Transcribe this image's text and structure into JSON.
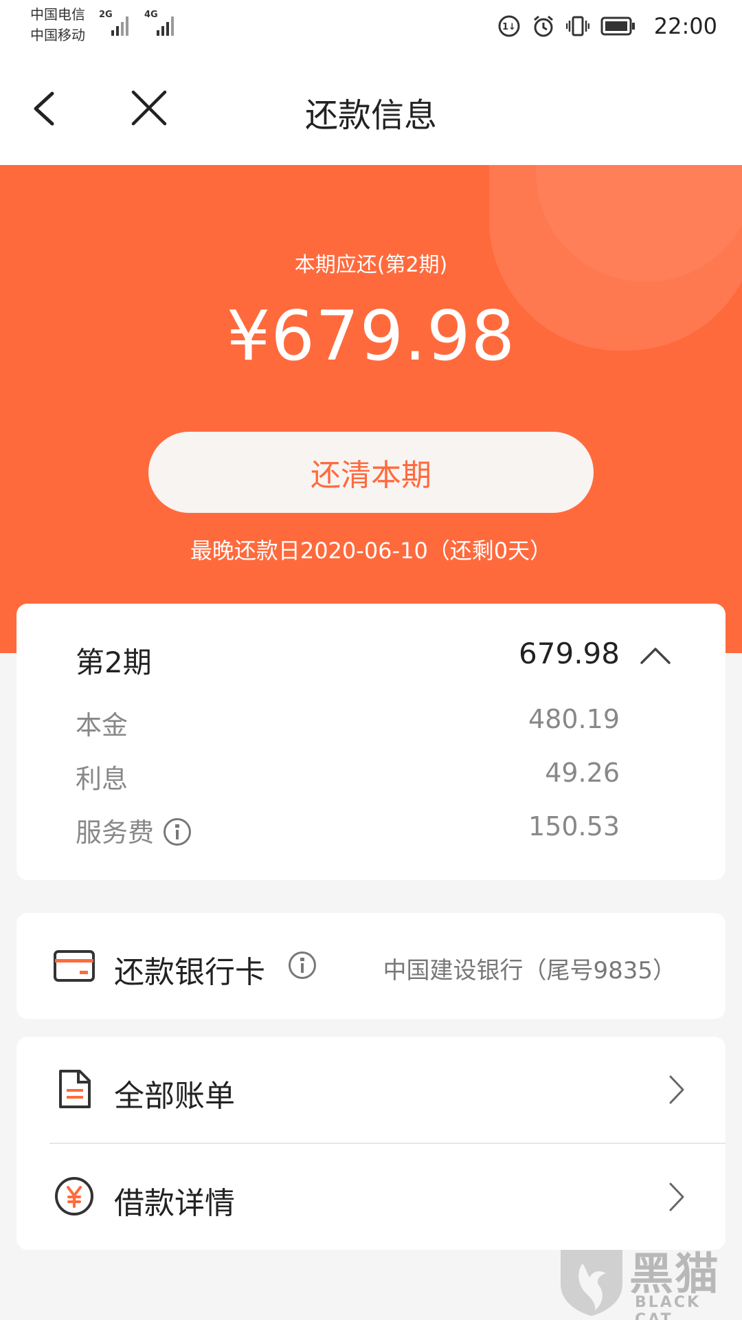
{
  "status_bar": {
    "carrier_1": "中国电信",
    "carrier_2": "中国移动",
    "signal_1_tag": "2G",
    "signal_2_tag": "4G",
    "time": "22:00",
    "icons": [
      "data-saver-icon",
      "alarm-icon",
      "vibrate-icon",
      "battery-icon"
    ]
  },
  "nav": {
    "title": "还款信息",
    "back_icon": "chevron-left-icon",
    "close_icon": "close-icon"
  },
  "hero": {
    "period_label": "本期应还(第2期)",
    "amount": "¥679.98",
    "pay_button": "还清本期",
    "due_date": "最晚还款日2020-06-10（还剩0天）",
    "background_color": "#ff6a3d"
  },
  "breakdown": {
    "period": "第2期",
    "total": "679.98",
    "toggle_icon": "chevron-up-icon",
    "rows": [
      {
        "label": "本金",
        "value": "480.19"
      },
      {
        "label": "利息",
        "value": "49.26"
      },
      {
        "label": "服务费",
        "value": "150.53",
        "has_info": true
      }
    ]
  },
  "bank_card": {
    "icon": "card-icon",
    "label": "还款银行卡",
    "value": "中国建设银行（尾号9835）"
  },
  "links": [
    {
      "icon": "document-icon",
      "label": "全部账单"
    },
    {
      "icon": "yuan-circle-icon",
      "label": "借款详情"
    }
  ],
  "watermark": {
    "text": "黑猫",
    "sub": "BLACK CAT"
  },
  "colors": {
    "accent": "#ff6a3d",
    "text_primary": "#222222",
    "text_secondary": "#888888"
  }
}
